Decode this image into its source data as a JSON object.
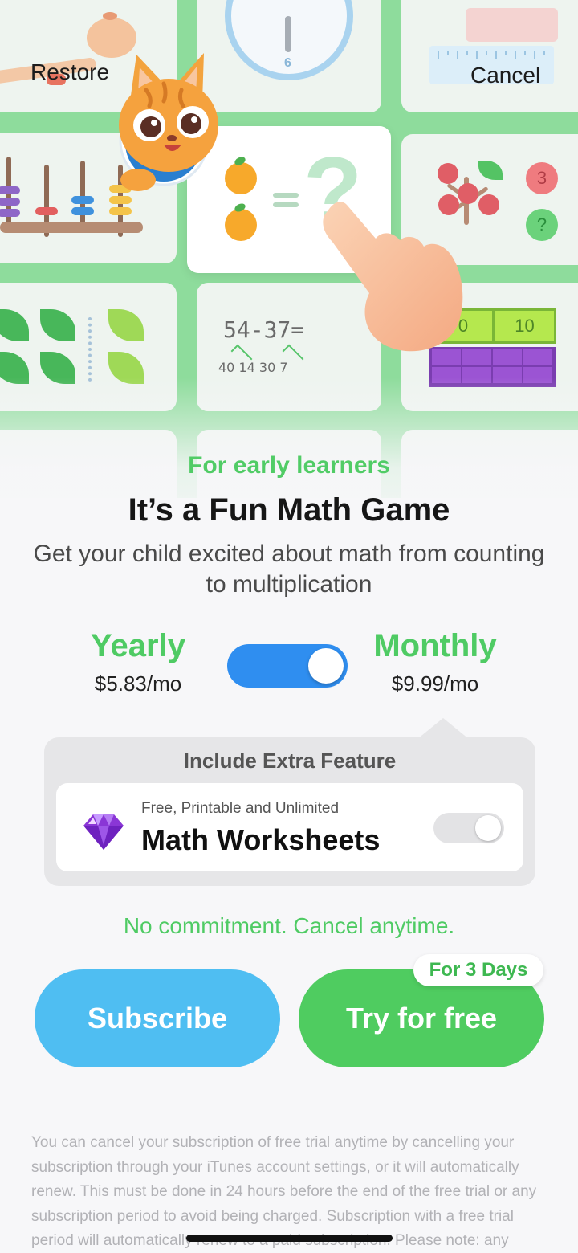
{
  "header": {
    "restore_label": "Restore",
    "cancel_label": "Cancel"
  },
  "hero": {
    "clock_number": "6",
    "equation": "54-37=",
    "equation_breakdown": "40 14  30  7",
    "block_labels": [
      "0",
      "10"
    ],
    "badge_three": "3",
    "badge_question": "?",
    "question_mark": "?"
  },
  "copy": {
    "tagline": "For early learners",
    "headline": "It’s a Fun Math Game",
    "subline": "Get your child excited about math from counting to multiplication"
  },
  "plans": {
    "yearly": {
      "label": "Yearly",
      "price": "$5.83/mo"
    },
    "monthly": {
      "label": "Monthly",
      "price": "$9.99/mo"
    },
    "selected": "monthly"
  },
  "extra_feature": {
    "title": "Include Extra Feature",
    "subtitle": "Free, Printable and Unlimited",
    "name": "Math Worksheets",
    "enabled": false
  },
  "commitment_text": "No commitment. Cancel anytime.",
  "cta": {
    "subscribe_label": "Subscribe",
    "trial_label": "Try for free",
    "trial_badge": "For 3 Days"
  },
  "legal_text": "You can cancel your subscription of free trial anytime by cancelling your subscription through your iTunes account settings, or it will automatically renew. This must be done in 24 hours before the end of the free trial or any subscription period to avoid being charged. Subscription with a free trial period will automatically renew to a paid subscription. Please note: any",
  "colors": {
    "accent_green": "#4fcb64",
    "toggle_blue": "#2f8ef0",
    "subscribe_blue": "#4fbef2",
    "trial_green": "#4fcc60"
  }
}
